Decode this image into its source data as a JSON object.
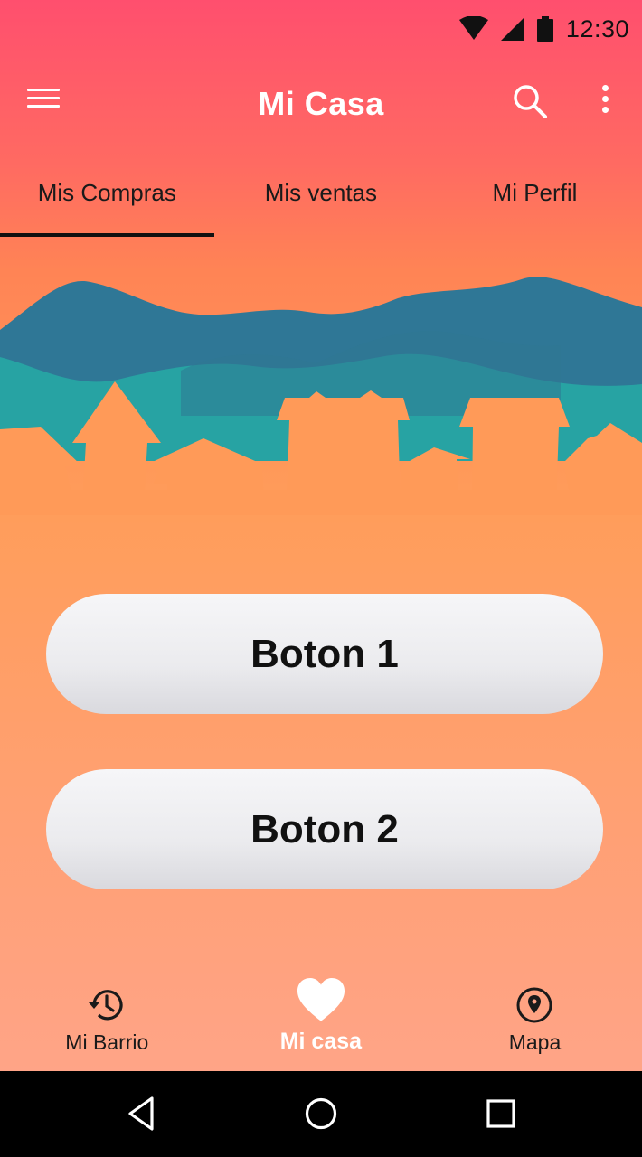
{
  "status_bar": {
    "time": "12:30",
    "icons": [
      "wifi-icon",
      "signal-icon",
      "battery-icon"
    ]
  },
  "app_bar": {
    "title": "Mi Casa",
    "icons": [
      "menu-icon",
      "search-icon",
      "more-vert-icon"
    ]
  },
  "tabs": [
    {
      "label": "Mis Compras",
      "active": true
    },
    {
      "label": "Mis ventas",
      "active": false
    },
    {
      "label": "Mi Perfil",
      "active": false
    }
  ],
  "buttons": {
    "button1_label": "Boton 1",
    "button2_label": "Boton 2"
  },
  "bottom_nav": [
    {
      "label": "Mi Barrio",
      "icon": "history-icon",
      "active": false
    },
    {
      "label": "Mi casa",
      "icon": "heart-icon",
      "active": true
    },
    {
      "label": "Mapa",
      "icon": "map-pin-icon",
      "active": false
    }
  ],
  "system_nav": [
    "back-icon",
    "home-icon",
    "recents-icon"
  ],
  "colors": {
    "gradient_top": "#ff4f6e",
    "gradient_bottom": "#ffa487",
    "mountain_dark": "#2f7a96",
    "mountain_teal": "#27a8a6",
    "houses": "#ff9a58"
  }
}
